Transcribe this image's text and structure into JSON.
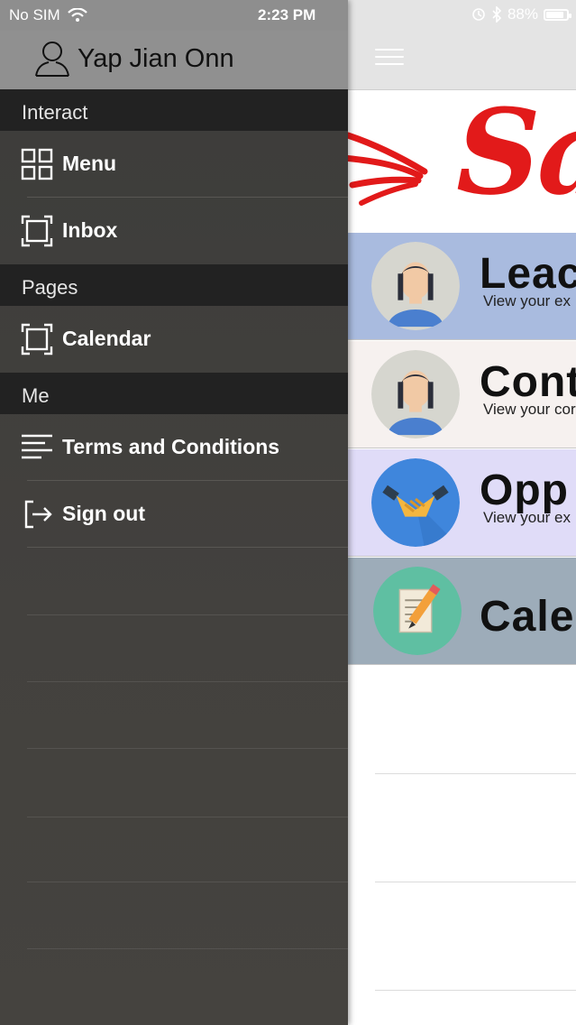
{
  "status_bar": {
    "carrier": "No SIM",
    "time": "2:23 PM",
    "battery_percent": "88%",
    "battery_level": 0.88
  },
  "drawer": {
    "profile_name": "Yap Jian Onn",
    "sections": [
      {
        "header": "Interact",
        "items": [
          {
            "label": "Menu",
            "icon": "grid-icon"
          },
          {
            "label": "Inbox",
            "icon": "frame-icon"
          }
        ]
      },
      {
        "header": "Pages",
        "items": [
          {
            "label": "Calendar",
            "icon": "frame-icon"
          }
        ]
      },
      {
        "header": "Me",
        "items": [
          {
            "label": "Terms and Conditions",
            "icon": "text-lines-icon"
          },
          {
            "label": "Sign out",
            "icon": "sign-out-icon"
          }
        ]
      }
    ]
  },
  "main": {
    "logo_text": "Sa",
    "tiles": [
      {
        "title": "Leac",
        "subtitle": "View your ex",
        "bg": "#a9bbdf",
        "icon": "person-avatar-icon"
      },
      {
        "title": "Cont",
        "subtitle": "View your cor",
        "bg": "#f6f1ef",
        "icon": "person-avatar-icon"
      },
      {
        "title": "Opp",
        "subtitle": "View your ex",
        "bg": "#e0dcf8",
        "icon": "handshake-icon"
      },
      {
        "title": "Cale",
        "subtitle": "",
        "bg": "#9dacb9",
        "icon": "notepad-pencil-icon"
      }
    ]
  },
  "colors": {
    "drawer_bg": "#43413e",
    "section_header_bg": "#222222",
    "logo_red": "#e21a1a"
  }
}
